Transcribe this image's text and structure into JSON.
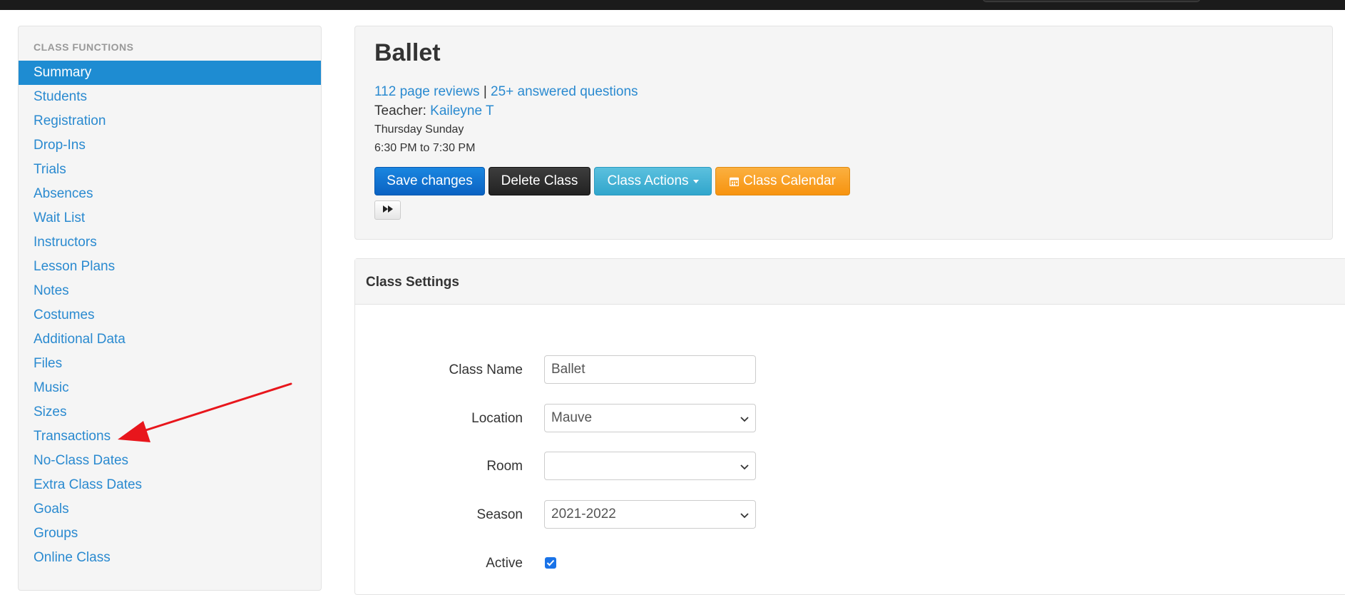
{
  "sidebar": {
    "header": "CLASS FUNCTIONS",
    "items": [
      {
        "label": "Summary",
        "active": true
      },
      {
        "label": "Students"
      },
      {
        "label": "Registration"
      },
      {
        "label": "Drop-Ins"
      },
      {
        "label": "Trials"
      },
      {
        "label": "Absences"
      },
      {
        "label": "Wait List"
      },
      {
        "label": "Instructors"
      },
      {
        "label": "Lesson Plans"
      },
      {
        "label": "Notes"
      },
      {
        "label": "Costumes"
      },
      {
        "label": "Additional Data"
      },
      {
        "label": "Files"
      },
      {
        "label": "Music"
      },
      {
        "label": "Sizes"
      },
      {
        "label": "Transactions"
      },
      {
        "label": "No-Class Dates"
      },
      {
        "label": "Extra Class Dates"
      },
      {
        "label": "Goals"
      },
      {
        "label": "Groups"
      },
      {
        "label": "Online Class"
      }
    ]
  },
  "class_header": {
    "title": "Ballet",
    "reviews_link": "112 page reviews",
    "separator": "|",
    "questions_link": "25+ answered questions",
    "teacher_label": "Teacher:",
    "teacher_name": "Kaileyne T",
    "days": "Thursday Sunday",
    "time": "6:30 PM to 7:30 PM"
  },
  "buttons": {
    "save": "Save changes",
    "delete": "Delete Class",
    "actions": "Class Actions",
    "calendar": "Class Calendar"
  },
  "settings": {
    "title": "Class Settings",
    "fields": {
      "class_name": {
        "label": "Class Name",
        "value": "Ballet"
      },
      "location": {
        "label": "Location",
        "value": "Mauve"
      },
      "room": {
        "label": "Room",
        "value": ""
      },
      "season": {
        "label": "Season",
        "value": "2021-2022"
      },
      "active": {
        "label": "Active",
        "checked": true
      }
    }
  },
  "colors": {
    "link": "#2a8ad0",
    "active_item": "#1e8cd2",
    "save_button": "#0a62c2",
    "delete_button": "#222222",
    "actions_button": "#31a6cc",
    "calendar_button": "#f7930f",
    "annotation_arrow": "#e8161c"
  },
  "icons": {
    "calendar": "calendar-icon",
    "fast_forward": "fast-forward-icon",
    "dropdown": "chevron-down-icon",
    "checkbox": "checkmark-icon"
  }
}
